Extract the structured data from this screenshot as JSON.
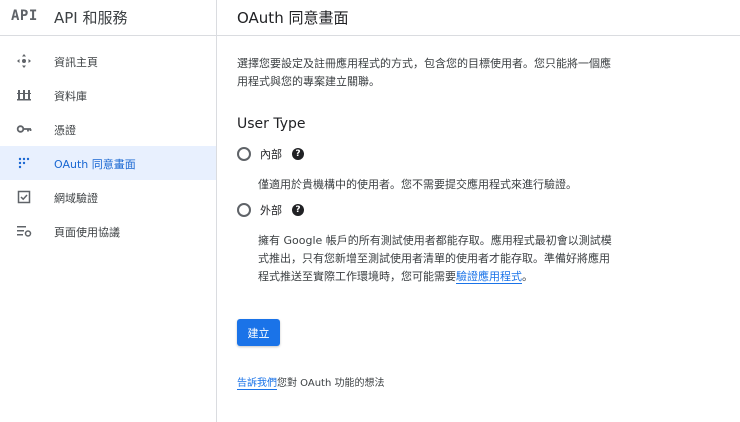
{
  "brand": {
    "logo_text": "API",
    "title": "API 和服務"
  },
  "sidebar": {
    "items": [
      {
        "label": "資訊主頁",
        "icon": "dashboard-icon"
      },
      {
        "label": "資料庫",
        "icon": "library-icon"
      },
      {
        "label": "憑證",
        "icon": "key-icon"
      },
      {
        "label": "OAuth 同意畫面",
        "icon": "consent-screen-icon",
        "active": true
      },
      {
        "label": "網域驗證",
        "icon": "checkbox-icon"
      },
      {
        "label": "頁面使用協議",
        "icon": "settings-list-icon"
      }
    ]
  },
  "header": {
    "title": "OAuth 同意畫面"
  },
  "main": {
    "intro_line1": "選擇您要設定及註冊應用程式的方式，包含您的目標使用者。您只能將一個應",
    "intro_line2": "用程式與您的專案建立關聯。",
    "section_title": "User Type",
    "options": [
      {
        "label": "內部",
        "help": "?",
        "desc_lines": [
          "僅適用於貴機構中的使用者。您不需要提交應用程式來進行驗證。"
        ]
      },
      {
        "label": "外部",
        "help": "?",
        "desc_lines": [
          "擁有 Google 帳戶的所有測試使用者都能存取。應用程式最初會以測試模",
          "式推出，只有您新增至測試使用者清單的使用者才能存取。準備好將應用",
          "程式推送至實際工作環境時，您可能需要"
        ],
        "desc_link": "驗證應用程式",
        "desc_tail": "。"
      }
    ],
    "create_button": "建立",
    "feedback_link": "告訴我們",
    "feedback_text": "您對 OAuth 功能的想法"
  },
  "colors": {
    "accent": "#1a73e8",
    "active_bg": "#e8f0fe",
    "active_text": "#1967d2"
  }
}
